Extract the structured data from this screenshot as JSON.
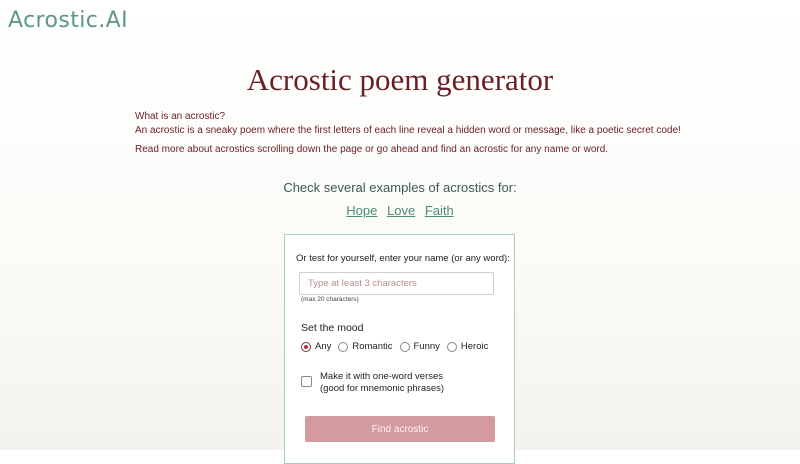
{
  "logo": "Acrostic.AI",
  "title": "Acrostic poem generator",
  "intro": {
    "question": "What is an acrostic?",
    "definition": "An acrostic is a sneaky poem where the first letters of each line reveal a hidden word or message, like a poetic secret code!",
    "read_more": "Read more about acrostics scrolling down the page or go ahead and find an acrostic for any name or word."
  },
  "examples": {
    "heading": "Check several examples of acrostics for:",
    "links": [
      "Hope",
      "Love",
      "Faith"
    ]
  },
  "form": {
    "prompt": "Or test for yourself, enter your name (or any word):",
    "input_placeholder": "Type at least 3 characters",
    "input_value": "",
    "max_note": "(max 20 characters)",
    "mood_label": "Set the mood",
    "moods": [
      "Any",
      "Romantic",
      "Funny",
      "Heroic"
    ],
    "selected_mood": "Any",
    "one_word_line1": "Make it with one-word verses",
    "one_word_line2": "(good for mnemonic phrases)",
    "one_word_checked": false,
    "button_label": "Find acrostic"
  },
  "colors": {
    "brand": "#5d9886",
    "title": "#6b1f24",
    "button": "#d39aa0",
    "radio_selected": "#b0313f",
    "card_border": "#a9cdbd"
  }
}
